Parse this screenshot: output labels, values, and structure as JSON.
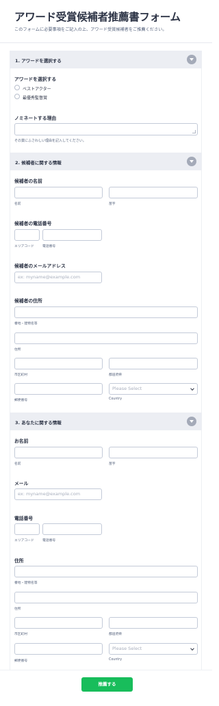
{
  "form": {
    "title": "アワード受賞候補者推薦書フォーム",
    "subtitle": "このフォームに必要事項をご記入の上、アワード受賞候補者をご推薦ください。",
    "submit_label": "推薦する"
  },
  "section1": {
    "title": "1. アワードを選択する",
    "award_label": "アワードを選択する",
    "options": [
      "ベストアクター",
      "最優秀監督賞"
    ],
    "reason_label": "ノミネートする理由",
    "reason_help": "その賞にふさわしい理由を記入してください。"
  },
  "section2": {
    "title": "2. 候補者に関する情報",
    "name_label": "候補者の名前",
    "first_name": "名前",
    "last_name": "苗字",
    "phone_label": "候補者の電話番号",
    "area_code": "エリアコード",
    "phone_number": "電話番号",
    "email_label": "候補者のメールアドレス",
    "email_placeholder": "ex: myname@example.com",
    "address_label": "候補者の住所",
    "street1": "番地・建物名等",
    "street2": "住所",
    "city": "市区町村",
    "state": "都道府県",
    "postal": "郵便番号",
    "country": "Country",
    "country_placeholder": "Please Select"
  },
  "section3": {
    "title": "3. あなたに関する情報",
    "name_label": "お名前",
    "first_name": "名前",
    "last_name": "苗字",
    "email_label": "メール",
    "email_placeholder": "ex: myname@example.com",
    "phone_label": "電話番号",
    "area_code": "エリアコード",
    "phone_number": "電話番号",
    "address_label": "住所",
    "street1": "番地・建物名等",
    "street2": "住所",
    "city": "市区町村",
    "state": "都道府県",
    "postal": "郵便番号",
    "country": "Country",
    "country_placeholder": "Please Select"
  },
  "colors": {
    "submit": "#18bd5b",
    "section_header": "#eceef3",
    "text": "#2c3345"
  }
}
